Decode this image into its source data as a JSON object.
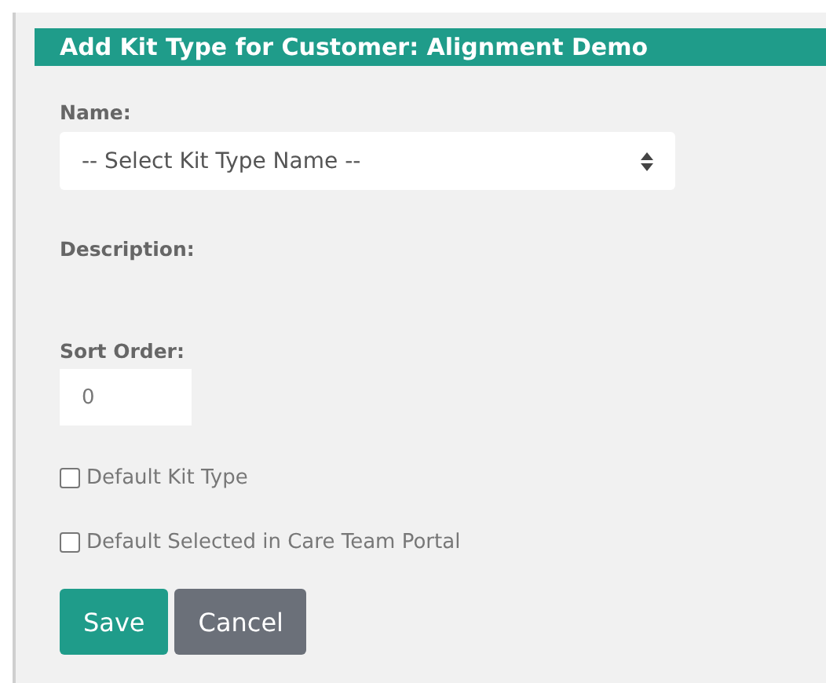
{
  "title": "Add Kit Type for Customer: Alignment Demo",
  "name_field": {
    "label": "Name:",
    "placeholder": "-- Select Kit Type Name --"
  },
  "description": {
    "label": "Description:"
  },
  "sort_order": {
    "label": "Sort Order:",
    "value": "0"
  },
  "checkboxes": [
    {
      "label": "Default Kit Type",
      "checked": false
    },
    {
      "label": "Default Selected in Care Team Portal",
      "checked": false
    }
  ],
  "buttons": [
    {
      "label": "Save",
      "kind": "primary"
    },
    {
      "label": "Cancel",
      "kind": "secondary"
    }
  ]
}
